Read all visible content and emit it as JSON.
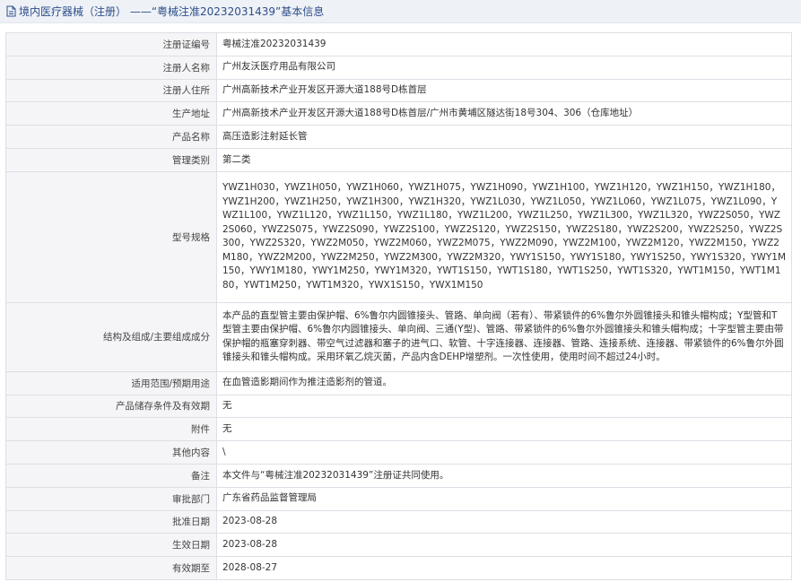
{
  "header": {
    "title": "境内医疗器械（注册） ——“粤械注准20232031439”基本信息"
  },
  "rows": [
    {
      "label": "注册证编号",
      "value": "粤械注准20232031439"
    },
    {
      "label": "注册人名称",
      "value": "广州友沃医疗用品有限公司"
    },
    {
      "label": "注册人住所",
      "value": "广州高新技术产业开发区开源大道188号D栋首层"
    },
    {
      "label": "生产地址",
      "value": "广州高新技术产业开发区开源大道188号D栋首层/广州市黄埔区隧达街18号304、306（仓库地址）"
    },
    {
      "label": "产品名称",
      "value": "高压造影注射延长管"
    },
    {
      "label": "管理类别",
      "value": "第二类"
    },
    {
      "label": "型号规格",
      "value": "YWZ1H030，YWZ1H050，YWZ1H060，YWZ1H075，YWZ1H090，YWZ1H100，YWZ1H120，YWZ1H150，YWZ1H180，YWZ1H200，YWZ1H250，YWZ1H300，YWZ1H320，YWZ1L030，YWZ1L050，YWZ1L060，YWZ1L075，YWZ1L090，YWZ1L100，YWZ1L120，YWZ1L150，YWZ1L180，YWZ1L200，YWZ1L250，YWZ1L300，YWZ1L320，YWZ2S050，YWZ2S060，YWZ2S075，YWZ2S090，YWZ2S100，YWZ2S120，YWZ2S150，YWZ2S180，YWZ2S200，YWZ2S250，YWZ2S300，YWZ2S320，YWZ2M050，YWZ2M060，YWZ2M075，YWZ2M090，YWZ2M100，YWZ2M120，YWZ2M150，YWZ2M180，YWZ2M200，YWZ2M250，YWZ2M300，YWZ2M320，YWY1S150，YWY1S180，YWY1S250，YWY1S320，YWY1M150，YWY1M180，YWY1M250，YWY1M320，YWT1S150，YWT1S180，YWT1S250，YWT1S320，YWT1M150，YWT1M180，YWT1M250，YWT1M320，YWX1S150，YWX1M150"
    },
    {
      "label": "结构及组成/主要组成成分",
      "value": "本产品的直型管主要由保护帽、6%鲁尔内圆锥接头、管路、单向阀（若有）、带紧锁件的6%鲁尔外圆锥接头和锥头帽构成；Y型管和T型管主要由保护帽、6%鲁尔内圆锥接头、单向阀、三通(Y型)、管路、带紧锁件的6%鲁尔外圆锥接头和锥头帽构成；十字型管主要由带保护帽的瓶塞穿刺器、带空气过滤器和塞子的进气口、软管、十字连接器、连接器、管路、连接系统、连接器、带紧锁件的6%鲁尔外圆锥接头和锥头帽构成。采用环氧乙烷灭菌，产品内含DEHP增塑剂。一次性使用，使用时间不超过24小时。"
    },
    {
      "label": "适用范围/预期用途",
      "value": "在血管造影期间作为推注造影剂的管道。"
    },
    {
      "label": "产品储存条件及有效期",
      "value": "无"
    },
    {
      "label": "附件",
      "value": "无"
    },
    {
      "label": "其他内容",
      "value": "\\"
    },
    {
      "label": "备注",
      "value": "本文件与“粤械注准20232031439”注册证共同使用。"
    },
    {
      "label": "审批部门",
      "value": "广东省药品监督管理局"
    },
    {
      "label": "批准日期",
      "value": "2023-08-28"
    },
    {
      "label": "生效日期",
      "value": "2023-08-28"
    },
    {
      "label": "有效期至",
      "value": "2028-08-27"
    }
  ]
}
